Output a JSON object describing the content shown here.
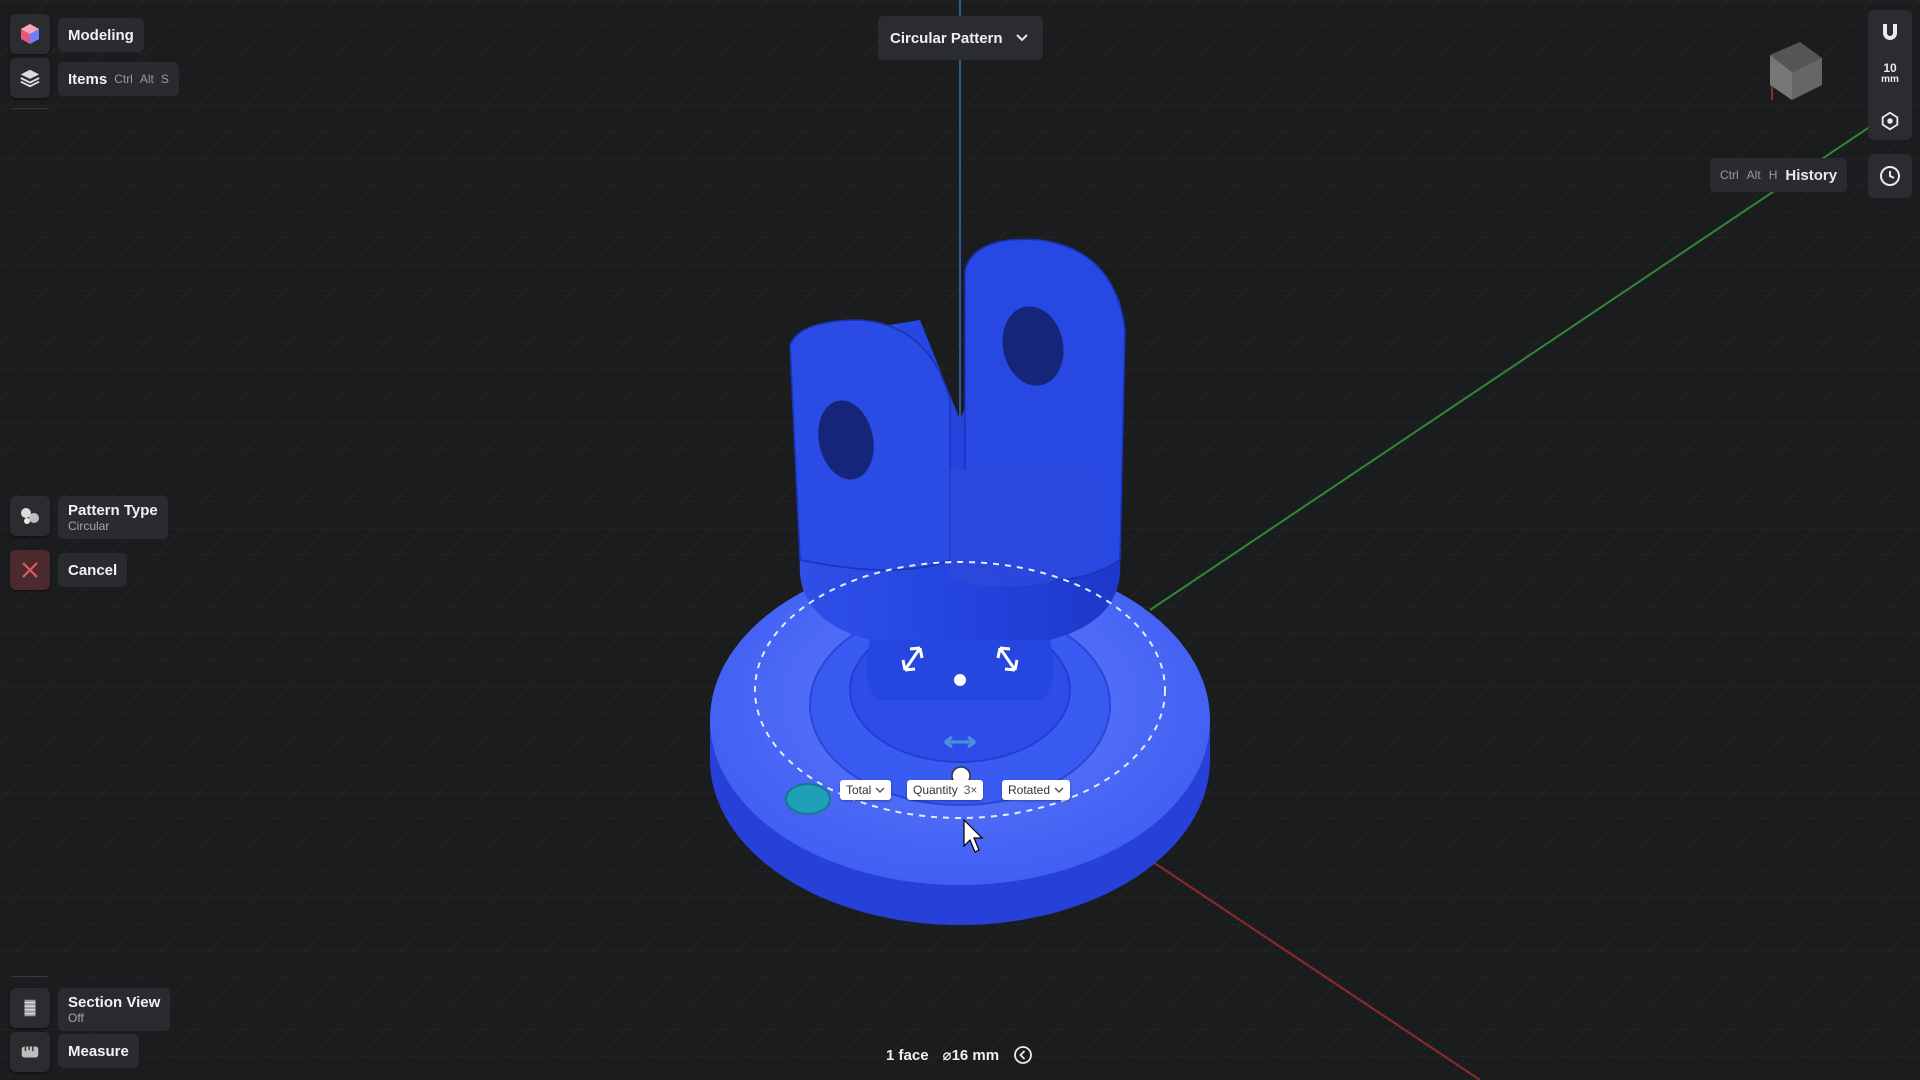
{
  "left_panel": {
    "modeling_label": "Modeling",
    "items_label": "Items",
    "items_shortcut": [
      "Ctrl",
      "Alt",
      "S"
    ],
    "pattern_type_title": "Pattern Type",
    "pattern_type_value": "Circular",
    "cancel_label": "Cancel",
    "section_view_title": "Section View",
    "section_view_value": "Off",
    "measure_label": "Measure"
  },
  "toolbar": {
    "command_dropdown": "Circular Pattern"
  },
  "right_panel": {
    "scale_value": "10",
    "scale_unit": "mm",
    "history_shortcut": [
      "Ctrl",
      "Alt",
      "H"
    ],
    "history_label": "History"
  },
  "pattern_controls": {
    "total_label": "Total",
    "quantity_label": "Quantity",
    "quantity_value": "3×",
    "rotated_label": "Rotated"
  },
  "status_bar": {
    "selection": "1 face",
    "diameter": "⌀16 mm"
  },
  "colors": {
    "background": "#1b1c1e",
    "model_blue": "#2b4fe6",
    "axis_green": "#2d8a3a",
    "axis_red": "#8a2d2d",
    "axis_blue": "#2d5a9a",
    "cancel_red": "#c0392b"
  },
  "icons": [
    "app-logo-icon",
    "layers-icon",
    "pattern-type-icon",
    "close-icon",
    "section-view-icon",
    "measure-icon",
    "chevron-down-icon",
    "view-cube-icon",
    "magnet-icon",
    "perspective-icon",
    "history-clock-icon",
    "back-arrow-icon"
  ]
}
